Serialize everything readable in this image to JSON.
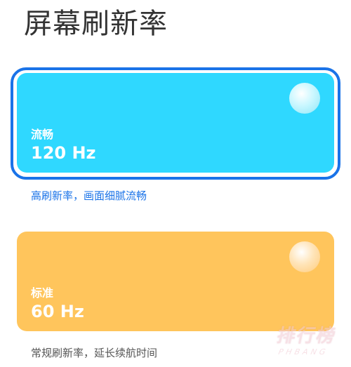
{
  "page_title": "屏幕刷新率",
  "options": [
    {
      "label": "流畅",
      "value": "120 Hz",
      "description": "高刷新率，画面细腻流畅",
      "selected": true,
      "color": "#2fd8ff",
      "description_color": "#1a73e8"
    },
    {
      "label": "标准",
      "value": "60 Hz",
      "description": "常规刷新率，延长续航时间",
      "selected": false,
      "color": "#ffc55c",
      "description_color": "#555555"
    }
  ],
  "watermark": {
    "main": "排行榜",
    "sub": "PHBANG"
  }
}
